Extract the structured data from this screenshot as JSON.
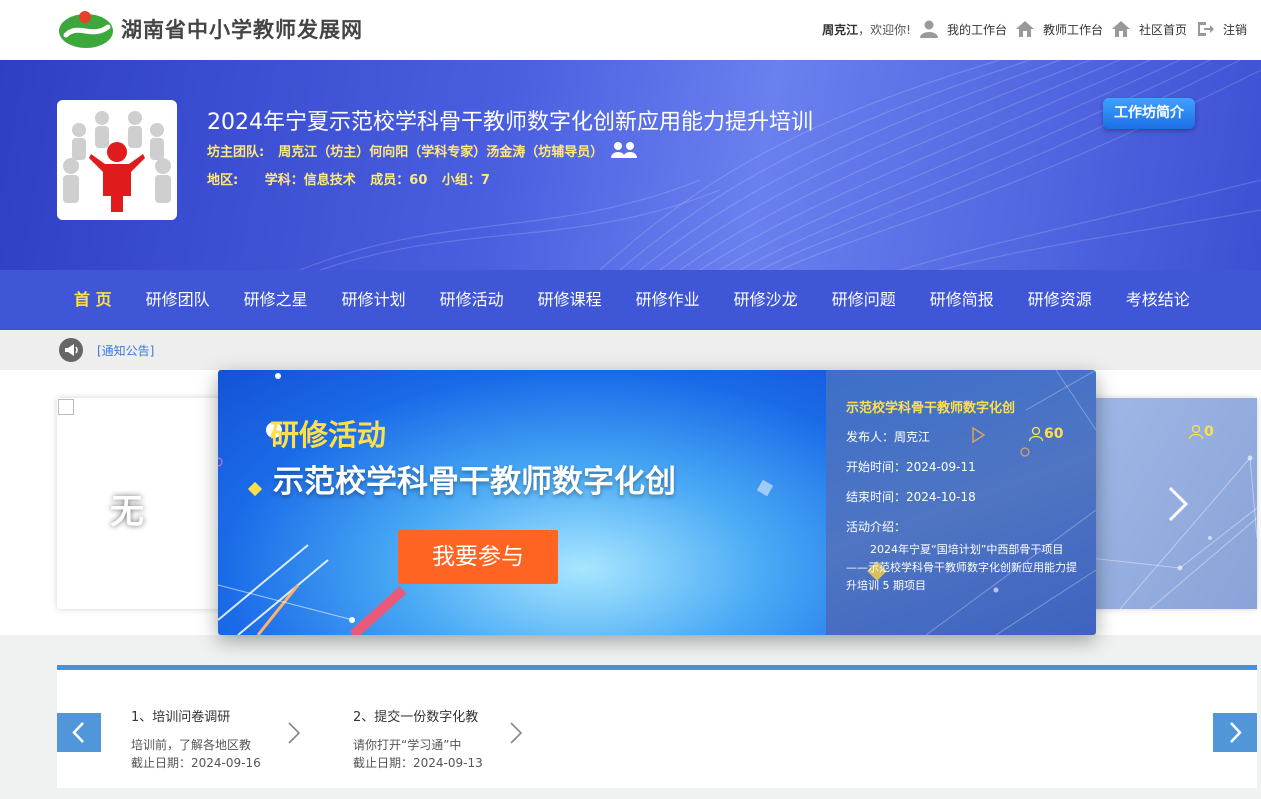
{
  "header": {
    "site_name": "湖南省中小学教师发展网",
    "greeting_name": "周克江",
    "greeting_suffix": "，欢迎你!",
    "links": [
      "我的工作台",
      "教师工作台",
      "社区首页",
      "注销"
    ]
  },
  "banner": {
    "title": "2024年宁夏示范校学科骨干教师数字化创新应用能力提升培训",
    "team_label": "坊主团队:",
    "team_members": "周克江（坊主）何向阳（学科专家）汤金涛（坊辅导员）",
    "region_label": "地区:",
    "subject": "学科：信息技术",
    "members": "成员：60",
    "groups": "小组：7",
    "intro_button": "工作坊简介"
  },
  "nav": {
    "items": [
      "首 页",
      "研修团队",
      "研修之星",
      "研修计划",
      "研修活动",
      "研修课程",
      "研修作业",
      "研修沙龙",
      "研修问题",
      "研修简报",
      "研修资源",
      "考核结论"
    ]
  },
  "notice": {
    "link": "[通知公告]"
  },
  "carousel": {
    "left_card_text": "无",
    "right_card_count": "0",
    "main": {
      "tag": "研修活动",
      "headline": "示范校学科骨干教师数字化创",
      "join_button": "我要参与",
      "title": "示范校学科骨干教师数字化创",
      "publisher": "发布人：周克江",
      "count": "60",
      "start": "开始时间：2024-09-11",
      "end": "结束时间：2024-10-18",
      "intro_label": "活动介绍：",
      "intro_text": "2024年宁夏“国培计划”中西部骨干项目——示范校学科骨干教师数字化创新应用能力提升培训 5 期项目"
    }
  },
  "tasks": {
    "items": [
      {
        "title": "1、培训问卷调研",
        "summary": "培训前，了解各地区教",
        "deadline": "截止日期：2024-09-16"
      },
      {
        "title": "2、提交一份数字化教",
        "summary": "请你打开“学习通”中",
        "deadline": "截止日期：2024-09-13"
      }
    ]
  },
  "colors": {
    "accent_yellow": "#ffe04a",
    "nav_blue": "#3f56d6",
    "join_orange": "#ff6422",
    "task_blue": "#5196d8"
  }
}
